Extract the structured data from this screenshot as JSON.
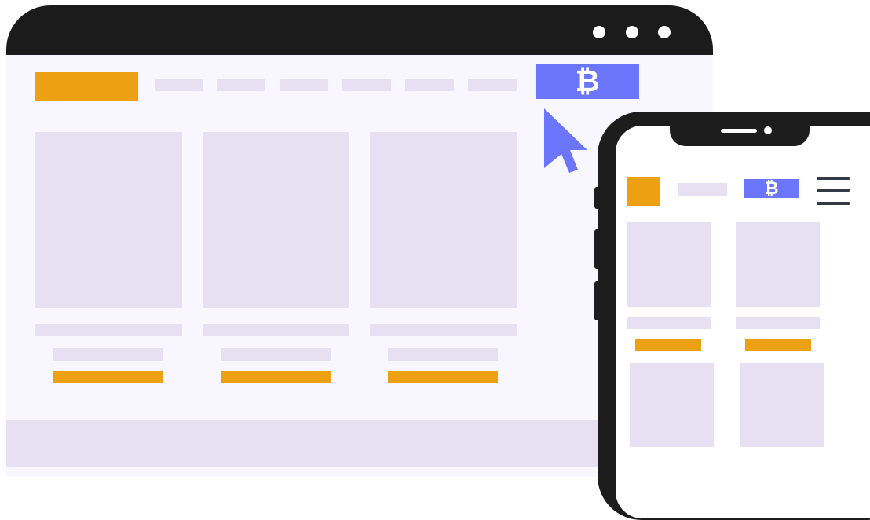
{
  "desktop": {
    "window_controls": [
      "dot",
      "dot",
      "dot"
    ],
    "nav_links": [
      "",
      "",
      "",
      "",
      "",
      ""
    ],
    "bitcoin_button": {
      "glyph": "₿",
      "icon": "bitcoin-icon"
    },
    "products": [
      {
        "title": "",
        "subtitle": "",
        "cta": ""
      },
      {
        "title": "",
        "subtitle": "",
        "cta": ""
      },
      {
        "title": "",
        "subtitle": "",
        "cta": ""
      }
    ],
    "cursor_icon": "mouse-pointer-icon"
  },
  "mobile": {
    "bitcoin_button": {
      "glyph": "₿",
      "icon": "bitcoin-icon"
    },
    "menu_icon": "hamburger-menu-icon",
    "products": [
      {
        "title": "",
        "cta": ""
      },
      {
        "title": "",
        "cta": ""
      }
    ]
  },
  "colors": {
    "titlebar": "#1b1b1b",
    "page_background": "#f8f6fe",
    "placeholder": "#e6e0f2",
    "accent_orange": "#eda112",
    "accent_blue": "#6b76fc",
    "phone_frame": "#1d1d1d"
  }
}
